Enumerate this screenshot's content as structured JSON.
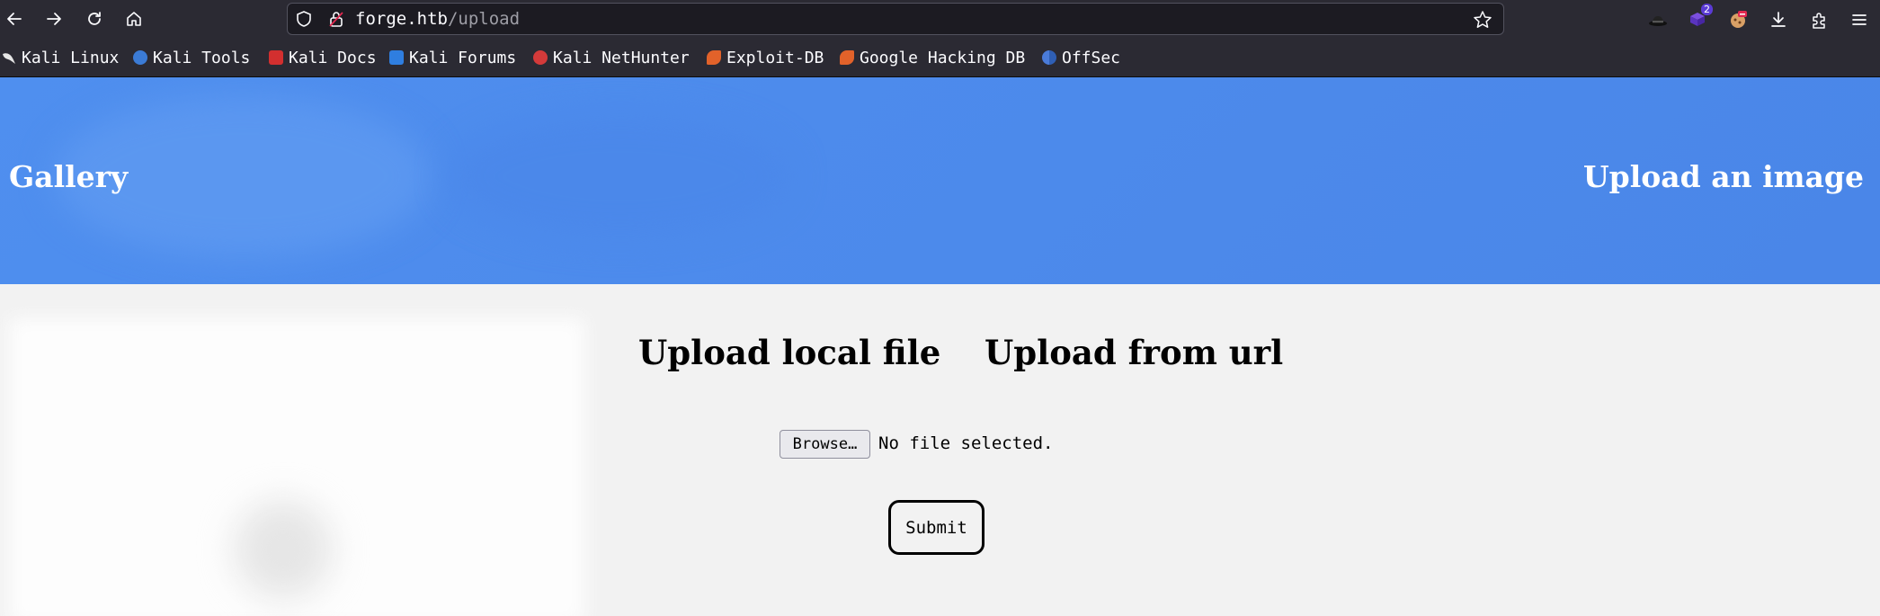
{
  "browser": {
    "url_host": "forge.htb",
    "url_path": "/upload",
    "extension_badge": "2",
    "bookmarks": [
      {
        "label": "Kali Linux",
        "color": "#1d1d1d"
      },
      {
        "label": "Kali Tools",
        "color": "#3b7bd6"
      },
      {
        "label": "Kali Docs",
        "color": "#d32f2f"
      },
      {
        "label": "Kali Forums",
        "color": "#2f7ee0"
      },
      {
        "label": "Kali NetHunter",
        "color": "#d43a3a"
      },
      {
        "label": "Exploit-DB",
        "color": "#e2622a"
      },
      {
        "label": "Google Hacking DB",
        "color": "#e2622a"
      },
      {
        "label": "OffSec",
        "color": "#4a7bd9"
      }
    ]
  },
  "page": {
    "header": {
      "gallery_label": "Gallery",
      "upload_label": "Upload an image",
      "banner_color": "#4a86e8"
    },
    "tabs": {
      "local_label": "Upload local file",
      "url_label": "Upload from url"
    },
    "form": {
      "browse_label": "Browse…",
      "file_status": "No file selected.",
      "submit_label": "Submit"
    }
  }
}
